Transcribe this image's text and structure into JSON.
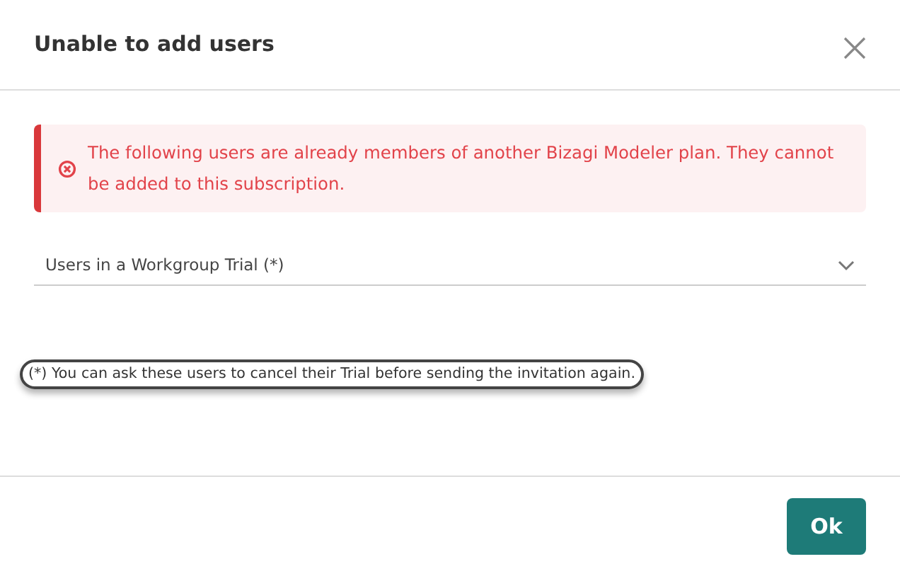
{
  "dialog": {
    "title": "Unable to add users"
  },
  "alert": {
    "message": "The following users are already members of another Bizagi Modeler plan. They cannot be added to this subscription."
  },
  "dropdown": {
    "label": "Users in a Workgroup Trial (*)"
  },
  "note": {
    "text": "(*) You can ask these users to cancel their Trial before sending the invitation again.",
    "highlighted": true
  },
  "buttons": [
    {
      "label": "Ok"
    }
  ]
}
